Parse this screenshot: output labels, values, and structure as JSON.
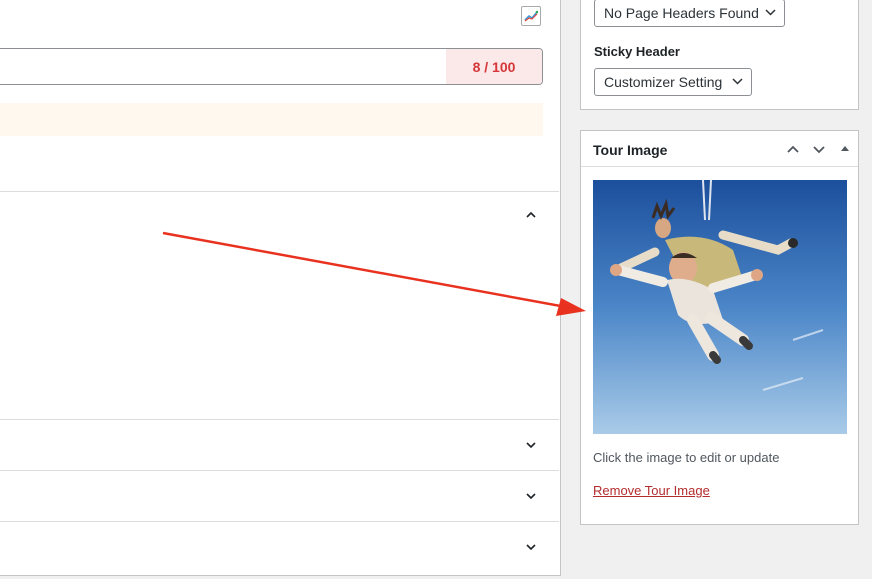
{
  "editor": {
    "trend_icon": "trend-chart-icon",
    "title_field": {
      "value": "",
      "char_count": "8 / 100",
      "count_color": "#d63638"
    },
    "sections": [
      {
        "state": "expanded",
        "icon": "chevron-up-icon"
      },
      {
        "state": "collapsed",
        "icon": "chevron-down-icon"
      },
      {
        "state": "collapsed",
        "icon": "chevron-down-icon"
      },
      {
        "state": "collapsed",
        "icon": "chevron-down-icon"
      }
    ]
  },
  "sidebar": {
    "page_headers_select": {
      "selected": "No Page Headers Found"
    },
    "sticky_header": {
      "label": "Sticky Header",
      "selected": "Customizer Setting"
    },
    "tour_image_box": {
      "title": "Tour Image",
      "header_icons": [
        "chevron-up-icon",
        "chevron-down-icon",
        "caret-up-icon"
      ],
      "image": "tandem-skydivers-photo",
      "help_text": "Click the image to edit or update",
      "remove_link": "Remove Tour Image",
      "link_color": "#b32d2e"
    }
  },
  "annotation": {
    "icon": "red-arrow",
    "color": "#e8321f"
  }
}
